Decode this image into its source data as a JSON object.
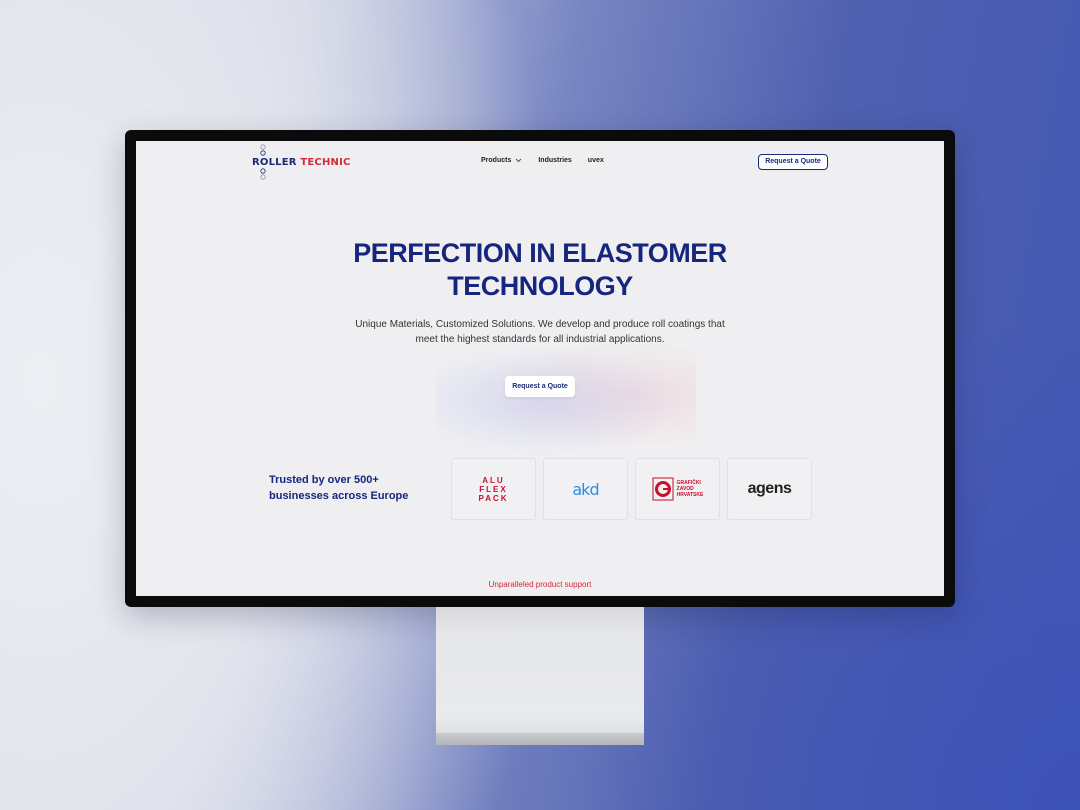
{
  "brand": {
    "part1": "ROLLER",
    "part2": "TECHNIC",
    "color_primary": "#16257e",
    "color_accent": "#d42a3a"
  },
  "nav": {
    "items": [
      {
        "label": "Products",
        "has_dropdown": true
      },
      {
        "label": "Industries"
      },
      {
        "label": "uvex"
      }
    ],
    "cta": "Request a Quote"
  },
  "hero": {
    "title_line1": "PERFECTION IN ELASTOMER",
    "title_line2": "TECHNOLOGY",
    "subtitle_line1": "Unique Materials, Customized Solutions. We develop and produce roll coatings that",
    "subtitle_line2": "meet the highest standards for all industrial applications.",
    "cta": "Request a Quote"
  },
  "trusted": {
    "line1": "Trusted by over 500+",
    "line2": "businesses across Europe",
    "logos": [
      {
        "name": "alu-flex-pack",
        "lines": [
          "ALU",
          "FLEX",
          "PACK"
        ]
      },
      {
        "name": "ako",
        "text": "akd"
      },
      {
        "name": "graficki-zavod-hrvatske",
        "lines": [
          "GRAFIČKI",
          "ZAVOD",
          "HRVATSKE"
        ]
      },
      {
        "name": "agens",
        "text": "agens"
      }
    ]
  },
  "section_note": "Unparalleled product support"
}
